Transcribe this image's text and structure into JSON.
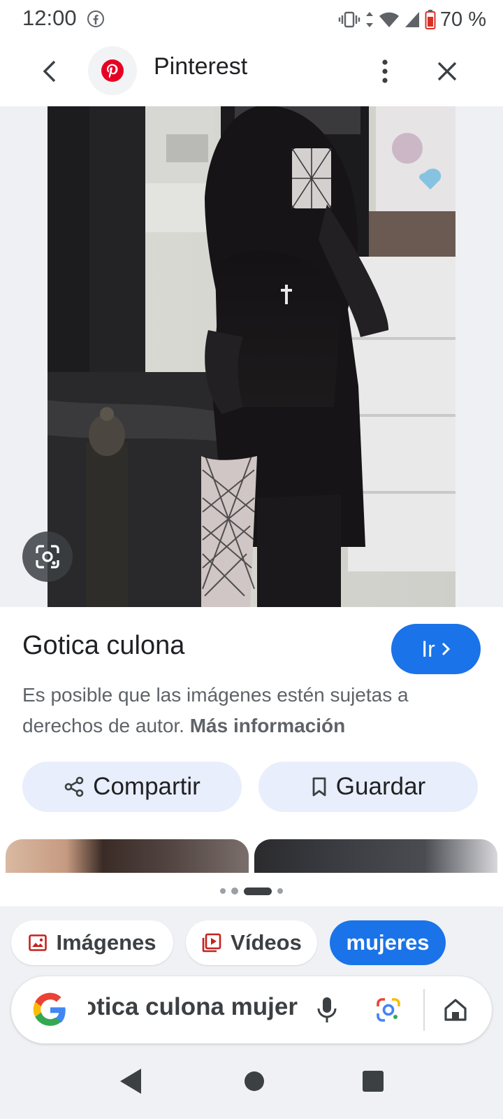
{
  "status_bar": {
    "time": "12:00",
    "battery": "70 %"
  },
  "header": {
    "site_name": "Pinterest",
    "site_color": "#e60023"
  },
  "result": {
    "title": "Gotica culona",
    "visit_label": "Ir",
    "copyright_text": "Es posible que las imágenes estén sujetas a derechos de autor.",
    "more_info_link": "Más información",
    "share_label": "Compartir",
    "save_label": "Guardar"
  },
  "chips": {
    "images": "Imágenes",
    "videos": "Vídeos",
    "women": "mujeres"
  },
  "search": {
    "query": "Gotica culona mujer"
  },
  "colors": {
    "accent": "#1a73e8",
    "pill_bg": "#e8eefb",
    "bottom_bg": "#eff1f5"
  },
  "icons": {
    "back": "chevron-left-icon",
    "more": "more-vert-icon",
    "close": "close-icon",
    "lens": "google-lens-icon",
    "share": "share-icon",
    "save": "bookmark-icon",
    "images_chip": "image-icon",
    "videos_chip": "video-icon",
    "mic": "mic-icon",
    "home": "home-icon"
  }
}
